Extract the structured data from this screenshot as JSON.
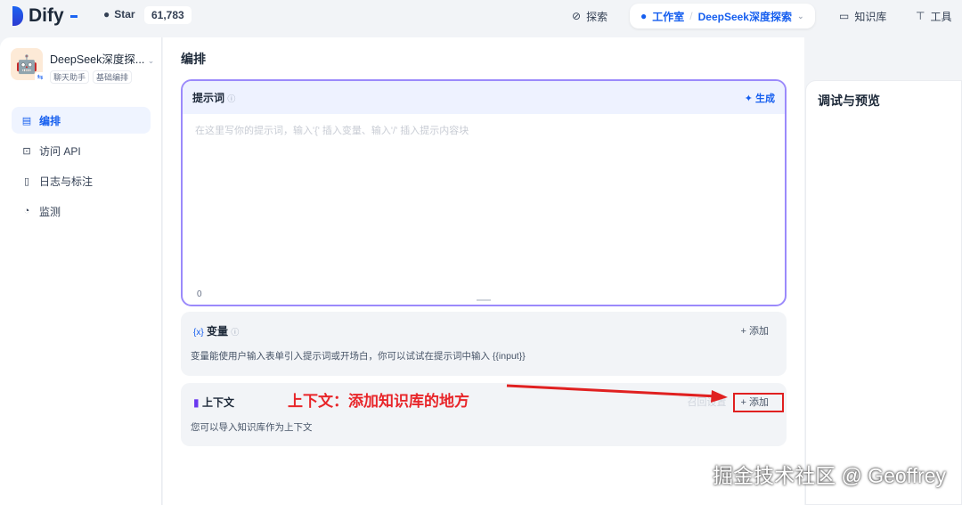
{
  "header": {
    "brand": "Dify",
    "star_label": "Star",
    "star_count": "61,783",
    "nav": {
      "explore": "探索",
      "studio": "工作室",
      "separator": "/",
      "current_app": "DeepSeek深度探索",
      "knowledge": "知识库",
      "tools": "工具"
    }
  },
  "sidebar": {
    "app_name": "DeepSeek深度探...",
    "tags": [
      "聊天助手",
      "基础编排"
    ],
    "items": [
      {
        "label": "编排",
        "active": true
      },
      {
        "label": "访问 API"
      },
      {
        "label": "日志与标注"
      },
      {
        "label": "监测"
      }
    ]
  },
  "main": {
    "title": "编排",
    "prompt": {
      "label": "提示词",
      "generate": "生成",
      "placeholder": "在这里写你的提示词，输入'{' 插入变量、输入'/' 插入提示内容块",
      "char_count": "0"
    },
    "variables": {
      "label": "变量",
      "add": "添加",
      "description": "变量能使用户输入表单引入提示词或开场白，你可以试试在提示词中输入 {{input}}"
    },
    "context": {
      "label": "上下文",
      "retrieval_settings": "召回设置",
      "add": "添加",
      "description": "您可以导入知识库作为上下文"
    }
  },
  "preview": {
    "title": "调试与预览"
  },
  "annotation": {
    "text": "上下文：添加知识库的地方",
    "color": "#e8262a"
  },
  "watermark": "掘金技术社区 @ Geoffrey"
}
